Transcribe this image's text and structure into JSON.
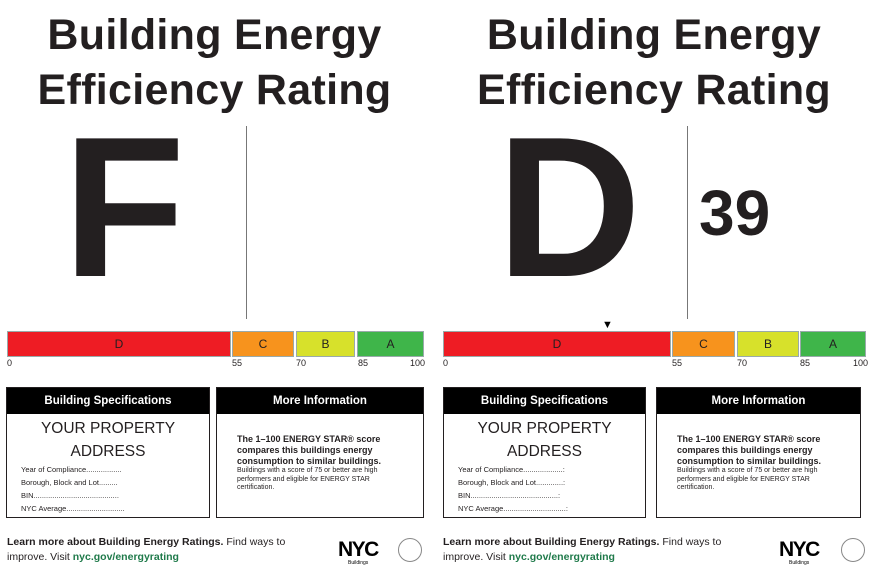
{
  "left_card": {
    "title_line1": "Building Energy",
    "title_line2": "Efficiency Rating",
    "grade": "F",
    "score": "",
    "scale": {
      "seg_d": "D",
      "seg_c": "C",
      "seg_b": "B",
      "seg_a": "A",
      "ticks": [
        "0",
        "55",
        "70",
        "85",
        "100"
      ]
    },
    "specs": {
      "header": "Building Specifications",
      "address_line1": "YOUR PROPERTY",
      "address_line2": "ADDRESS",
      "rows": [
        "Year of Compliance.................",
        "Borough, Block and Lot.........",
        "BIN.........................................",
        "NYC Average............................"
      ]
    },
    "info": {
      "header": "More Information",
      "bold": "The 1–100 ENERGY STAR® score compares this buildings energy consumption to similar buildings.",
      "small": "Buildings with a score of 75 or better are high performers and eligible for ENERGY STAR certification."
    },
    "footer": {
      "bold": "Learn more about Building Energy Ratings.",
      "rest": " Find ways to improve. Visit ",
      "link": "nyc.gov/energyrating"
    },
    "logo": {
      "nyc": "NYC",
      "sub": "Buildings"
    }
  },
  "right_card": {
    "title_line1": "Building Energy",
    "title_line2": "Efficiency Rating",
    "grade": "D",
    "score": "39",
    "marker": "▼",
    "scale": {
      "seg_d": "D",
      "seg_c": "C",
      "seg_b": "B",
      "seg_a": "A",
      "ticks": [
        "0",
        "55",
        "70",
        "85",
        "100"
      ]
    },
    "specs": {
      "header": "Building Specifications",
      "address_line1": "YOUR PROPERTY",
      "address_line2": "ADDRESS",
      "rows": [
        "Year of Compliance...................:",
        "Borough, Block and Lot.............:",
        "BIN..........................................:",
        "NYC Average..............................:"
      ]
    },
    "info": {
      "header": "More Information",
      "bold": "The 1–100 ENERGY STAR® score compares this buildings energy consumption to similar buildings.",
      "small": "Buildings with a score of 75 or better are high performers and eligible for ENERGY STAR certification."
    },
    "footer": {
      "bold": "Learn more about Building Energy Ratings.",
      "rest": " Find ways to improve. Visit ",
      "link": "nyc.gov/energyrating"
    },
    "logo": {
      "nyc": "NYC",
      "sub": "Buildings"
    }
  },
  "colors": {
    "grade_d": "#ee1c24",
    "grade_c": "#f7931d",
    "grade_b": "#d7e12b",
    "grade_a": "#3fb54a",
    "link": "#1f7a4a",
    "header_bg": "#000000"
  }
}
